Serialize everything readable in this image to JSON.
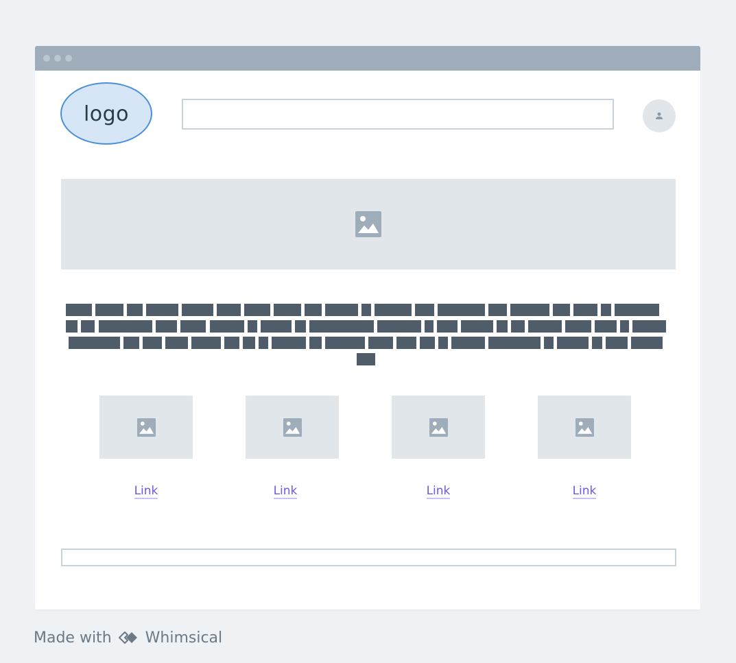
{
  "logo": {
    "label": "logo"
  },
  "search": {
    "placeholder": ""
  },
  "paragraph": {
    "label": ""
  },
  "cards": [
    {
      "link": "Link"
    },
    {
      "link": "Link"
    },
    {
      "link": "Link"
    },
    {
      "link": "Link"
    }
  ],
  "footer": {
    "value": ""
  },
  "credit": {
    "prefix": "Made with",
    "brand": "Whimsical"
  },
  "icons": {
    "hero": "image-icon",
    "thumb": "image-icon",
    "avatar": "user-icon",
    "brand": "whimsical-logo-icon"
  },
  "colors": {
    "background": "#eff2f5",
    "titlebar": "#9eadb9",
    "logo_fill": "#d6e6f7",
    "logo_border": "#4a90d6",
    "placeholder": "#e1e6eb",
    "text_block": "#4e5d69",
    "link": "#6e58e6"
  }
}
